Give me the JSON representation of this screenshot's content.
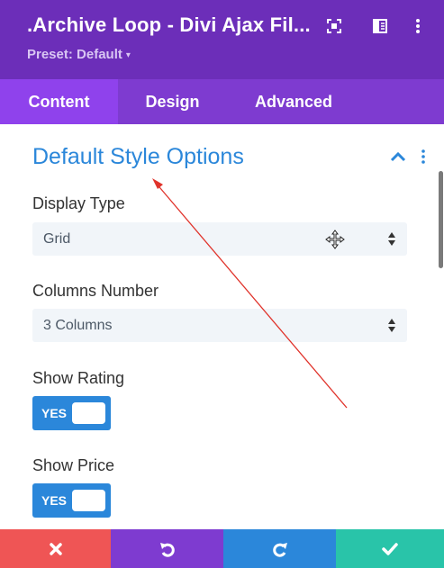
{
  "header": {
    "title": ".Archive Loop - Divi Ajax Fil...",
    "preset_label": "Preset: Default",
    "preset_caret": "▾",
    "icons": [
      "fullscreen-icon",
      "split-view-icon",
      "more-options-icon"
    ],
    "bg_color": "#6c2eb9"
  },
  "tabs": [
    {
      "label": "Content",
      "active": true
    },
    {
      "label": "Design",
      "active": false
    },
    {
      "label": "Advanced",
      "active": false
    }
  ],
  "section": {
    "title": "Default Style Options",
    "expanded": true
  },
  "fields": {
    "display_type": {
      "label": "Display Type",
      "value": "Grid"
    },
    "columns_number": {
      "label": "Columns Number",
      "value": "3 Columns"
    },
    "show_rating": {
      "label": "Show Rating",
      "toggle": "YES"
    },
    "show_price": {
      "label": "Show Price",
      "toggle": "YES"
    }
  },
  "footer": {
    "buttons": [
      {
        "name": "cancel",
        "icon": "close-icon",
        "color": "#ef5555"
      },
      {
        "name": "undo",
        "icon": "undo-icon",
        "color": "#7e3bd0"
      },
      {
        "name": "redo",
        "icon": "redo-icon",
        "color": "#2b87da"
      },
      {
        "name": "save",
        "icon": "check-icon",
        "color": "#29c4a9"
      }
    ]
  },
  "colors": {
    "accent_blue": "#2b87da",
    "tab_bar": "#7e3bd0",
    "tab_active": "#8f42ec",
    "annotation_arrow": "#e0332b"
  }
}
